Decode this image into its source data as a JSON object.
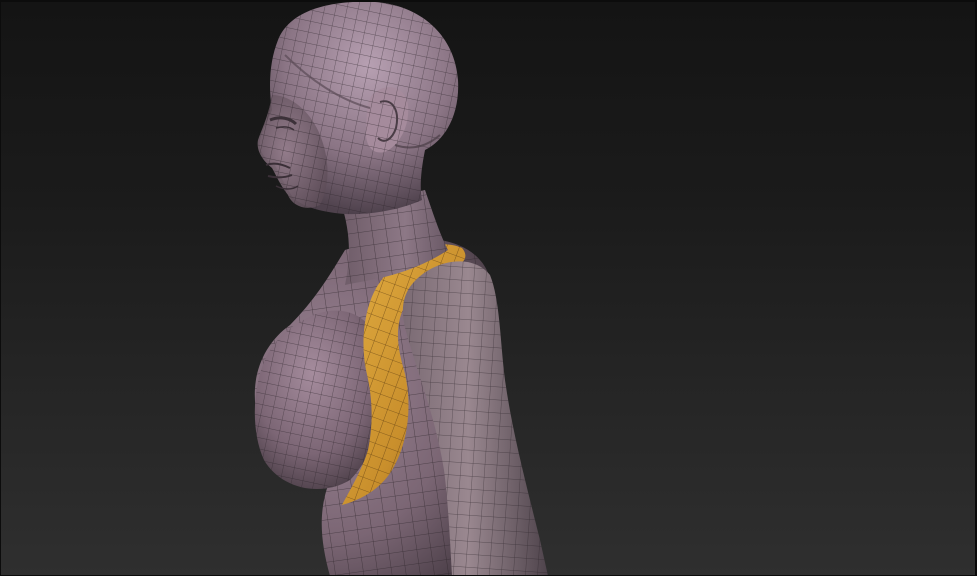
{
  "viewport": {
    "background_top": "#141414",
    "background_bottom": "#2f2f2f"
  },
  "model": {
    "skin_color": "#8a7480",
    "skin_shadow": "#4a3f47",
    "skin_highlight": "#b8a1b2",
    "wire_color": "#2a2228",
    "mask_color": "#d9a23a",
    "mask_shadow": "#8a5d1c"
  }
}
